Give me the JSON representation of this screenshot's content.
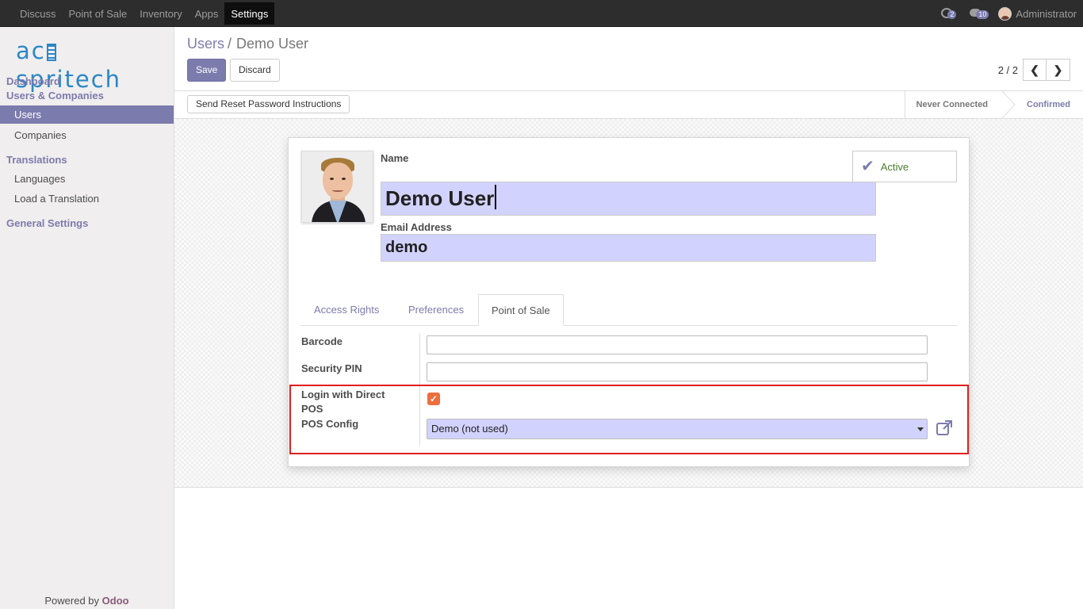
{
  "topbar": {
    "menu": [
      "Discuss",
      "Point of Sale",
      "Inventory",
      "Apps",
      "Settings"
    ],
    "active_menu": "Settings",
    "activity_count": "2",
    "message_count": "10",
    "user_name": "Administrator"
  },
  "sidebar": {
    "logo": "acespritech",
    "sections": {
      "dashboard": "Dashboard",
      "users_companies": "Users & Companies",
      "translations": "Translations",
      "general_settings": "General Settings"
    },
    "items": {
      "users": "Users",
      "companies": "Companies",
      "languages": "Languages",
      "load_translation": "Load a Translation"
    },
    "powered_prefix": "Powered by",
    "powered_brand": "Odoo"
  },
  "control_panel": {
    "breadcrumb_parent": "Users",
    "breadcrumb_sep": "/",
    "breadcrumb_current": "Demo User",
    "save_label": "Save",
    "discard_label": "Discard",
    "pager_value": "2 / 2"
  },
  "statusbar": {
    "reset_password_label": "Send Reset Password Instructions",
    "stages": [
      "Never Connected",
      "Confirmed"
    ]
  },
  "form": {
    "name_label": "Name",
    "name_value": "Demo User",
    "email_label": "Email Address",
    "email_value": "demo",
    "active_label": "Active",
    "tabs": [
      "Access Rights",
      "Preferences",
      "Point of Sale"
    ],
    "active_tab": "Point of Sale",
    "fields": {
      "barcode_label": "Barcode",
      "barcode_value": "",
      "security_pin_label": "Security PIN",
      "security_pin_value": "",
      "login_direct_pos_label": "Login with Direct POS",
      "login_direct_pos_checked": true,
      "pos_config_label": "POS Config",
      "pos_config_value": "Demo (not used)"
    }
  },
  "colors": {
    "accent": "#7c7bad",
    "highlight_border": "#e01f1f",
    "required_field_bg": "#d2d2ff",
    "checkbox": "#ee6e3e"
  }
}
